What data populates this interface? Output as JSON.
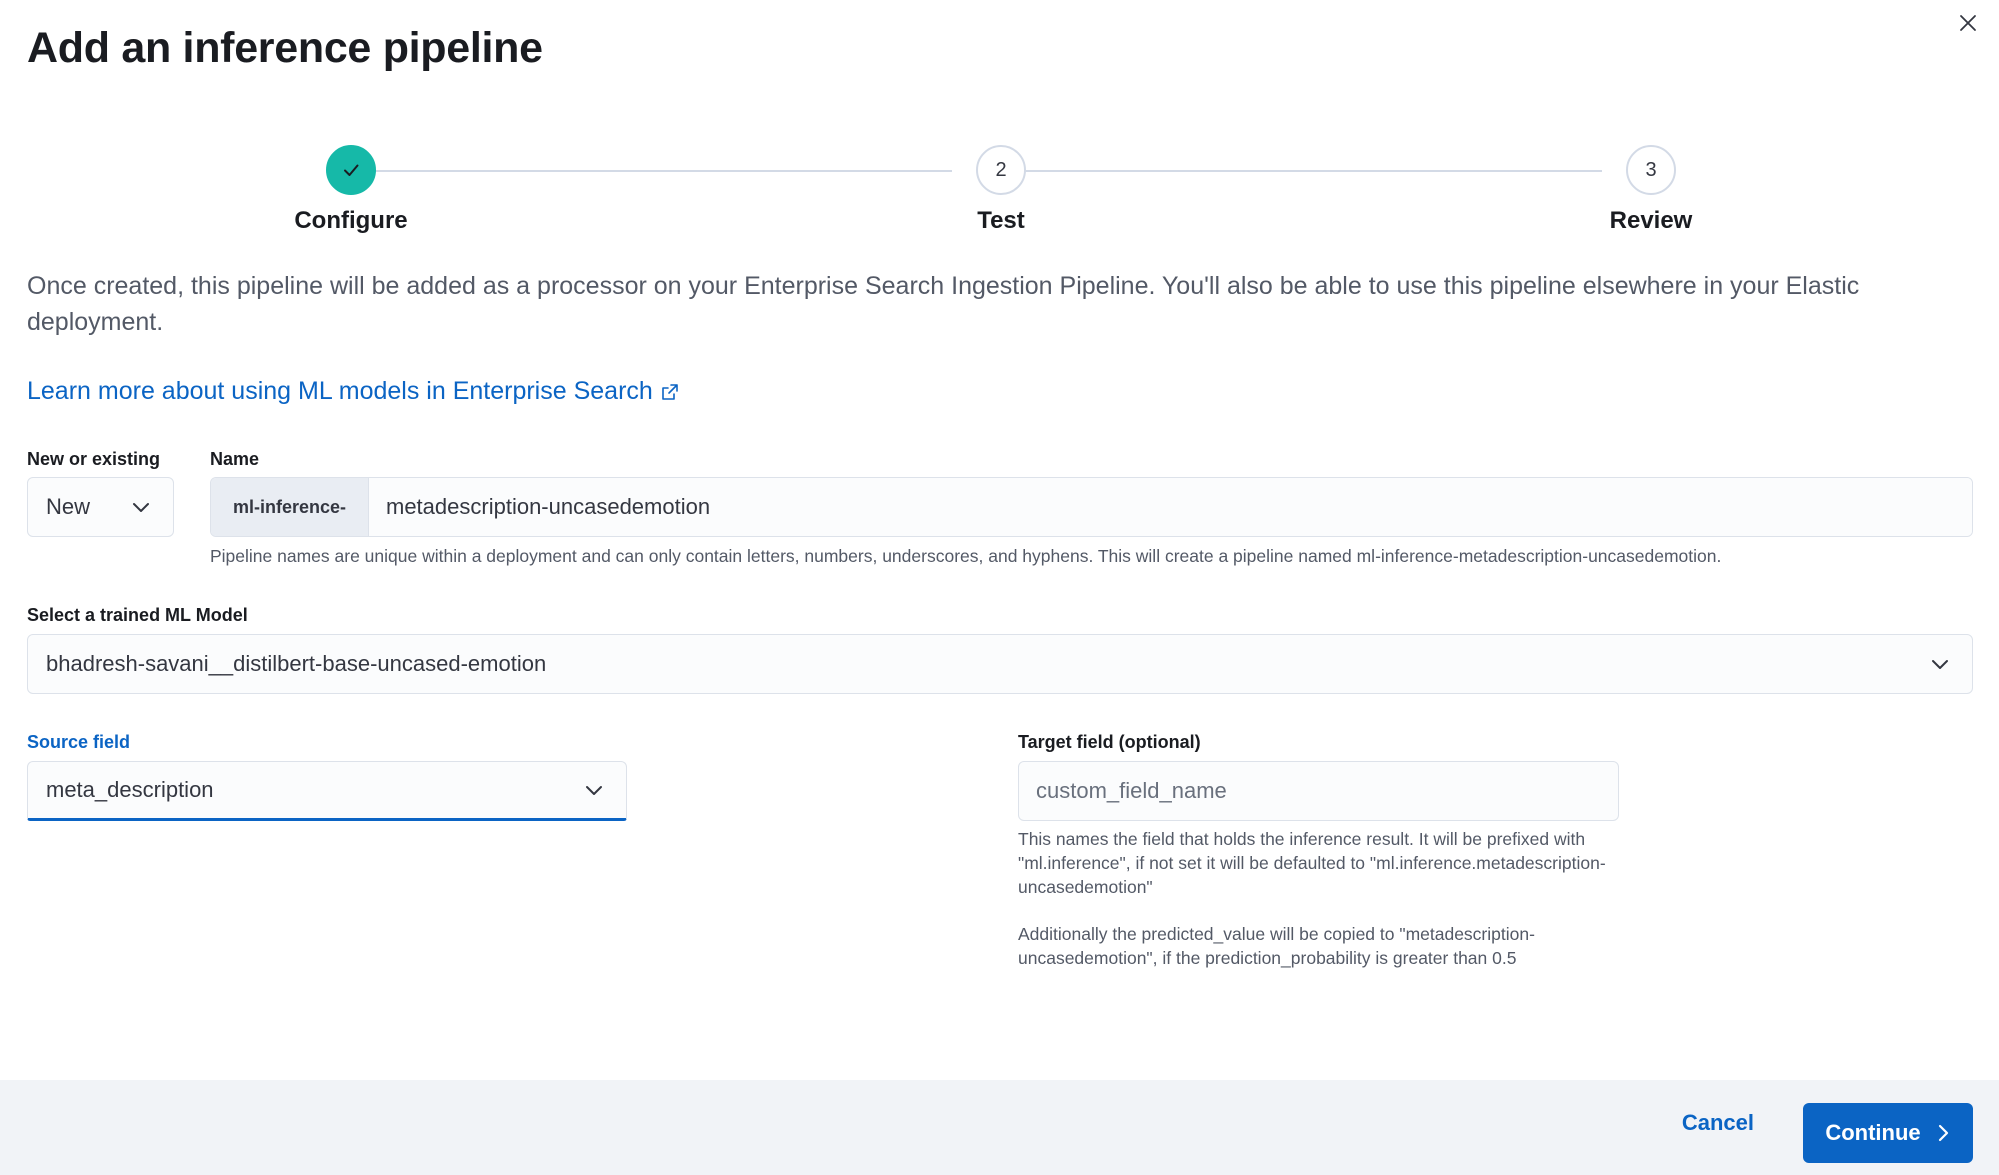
{
  "modal": {
    "title": "Add an inference pipeline",
    "close_icon": "close-icon"
  },
  "stepper": {
    "steps": [
      {
        "number": "",
        "label": "Configure",
        "status": "complete",
        "icon": "check-icon"
      },
      {
        "number": "2",
        "label": "Test",
        "status": "incomplete"
      },
      {
        "number": "3",
        "label": "Review",
        "status": "incomplete"
      }
    ]
  },
  "description": "Once created, this pipeline will be added as a processor on your Enterprise Search Ingestion Pipeline. You'll also be able to use this pipeline elsewhere in your Elastic deployment.",
  "learn_more": {
    "label": "Learn more about using ML models in Enterprise Search",
    "icon": "external-link-icon"
  },
  "new_or_existing": {
    "label": "New or existing",
    "value": "New"
  },
  "name": {
    "label": "Name",
    "prefix": "ml-inference-",
    "value": "metadescription-uncasedemotion",
    "help": "Pipeline names are unique within a deployment and can only contain letters, numbers, underscores, and hyphens. This will create a pipeline named ml-inference-metadescription-uncasedemotion."
  },
  "model": {
    "label": "Select a trained ML Model",
    "value": "bhadresh-savani__distilbert-base-uncased-emotion"
  },
  "source_field": {
    "label": "Source field",
    "value": "meta_description"
  },
  "target_field": {
    "label": "Target field (optional)",
    "placeholder": "custom_field_name",
    "help1": "This names the field that holds the inference result. It will be prefixed with \"ml.inference\", if not set it will be defaulted to \"ml.inference.metadescription-uncasedemotion\"",
    "help2": "Additionally the predicted_value will be copied to \"metadescription-uncasedemotion\", if the prediction_probability is greater than 0.5"
  },
  "footer": {
    "cancel_label": "Cancel",
    "continue_label": "Continue"
  },
  "colors": {
    "accent": "#0b64c4",
    "step_complete": "#16b9a8",
    "footer_bg": "#f1f3f7"
  }
}
